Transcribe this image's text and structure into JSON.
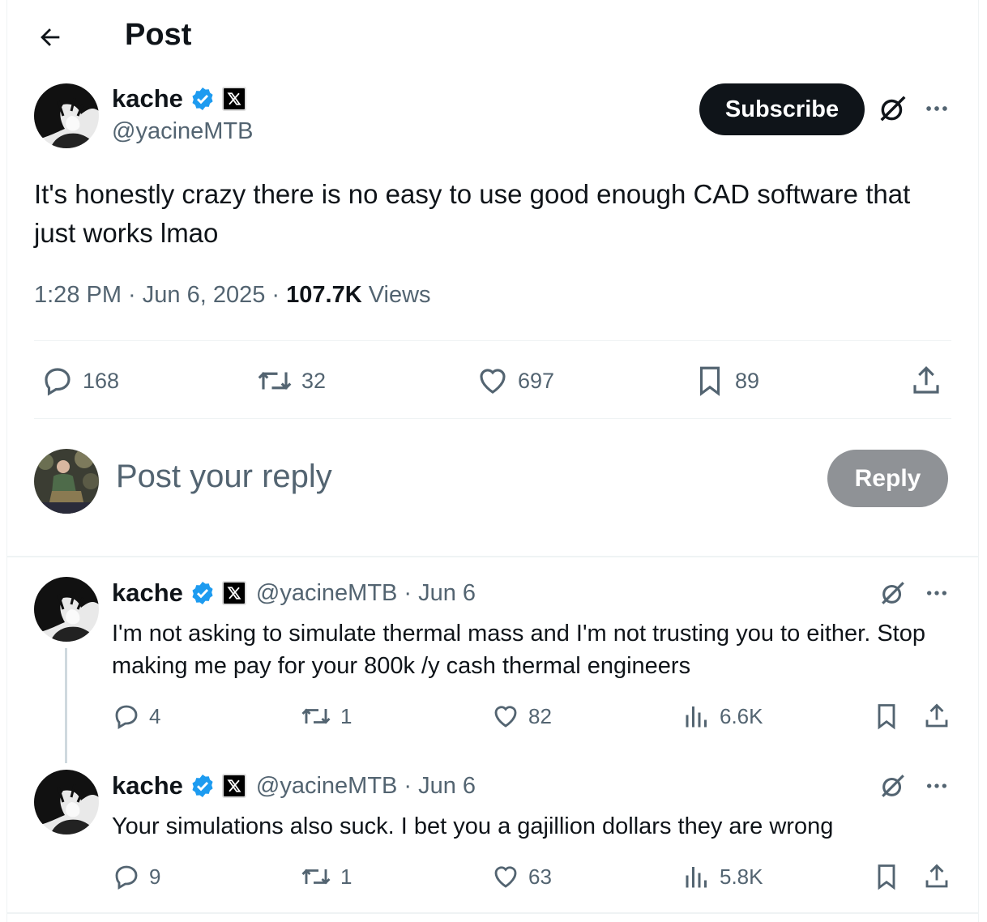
{
  "header": {
    "title": "Post"
  },
  "post": {
    "author": {
      "name": "kache",
      "handle": "@yacineMTB"
    },
    "subscribe_label": "Subscribe",
    "text": "It's honestly crazy there is no easy to use good enough CAD software that just works lmao",
    "time": "1:28 PM · Jun 6, 2025 · ",
    "views_count": "107.7K",
    "views_label": " Views",
    "stats": {
      "replies": "168",
      "reposts": "32",
      "likes": "697",
      "bookmarks": "89"
    }
  },
  "composer": {
    "placeholder": "Post your reply",
    "reply_label": "Reply"
  },
  "replies": [
    {
      "name": "kache",
      "handle": "@yacineMTB",
      "date": "· Jun 6",
      "text": "I'm not asking to simulate thermal mass and I'm not trusting you to either. Stop making me pay for your 800k /y cash thermal engineers",
      "stats": {
        "replies": "4",
        "reposts": "1",
        "likes": "82",
        "views": "6.6K"
      }
    },
    {
      "name": "kache",
      "handle": "@yacineMTB",
      "date": "· Jun 6",
      "text": "Your simulations also suck. I bet you a gajillion dollars they are wrong",
      "stats": {
        "replies": "9",
        "reposts": "1",
        "likes": "63",
        "views": "5.8K"
      }
    }
  ],
  "colors": {
    "verified": "#1d9bf0",
    "primary_text": "#0f1419",
    "secondary_text": "#536471",
    "subscribe_bg": "#0f1419",
    "reply_btn_bg": "#8f9296"
  },
  "icons": [
    "back-arrow-icon",
    "verified-badge-icon",
    "x-affiliate-icon",
    "grok-icon",
    "more-icon",
    "reply-icon",
    "repost-icon",
    "like-icon",
    "bookmark-icon",
    "share-icon",
    "views-icon"
  ]
}
